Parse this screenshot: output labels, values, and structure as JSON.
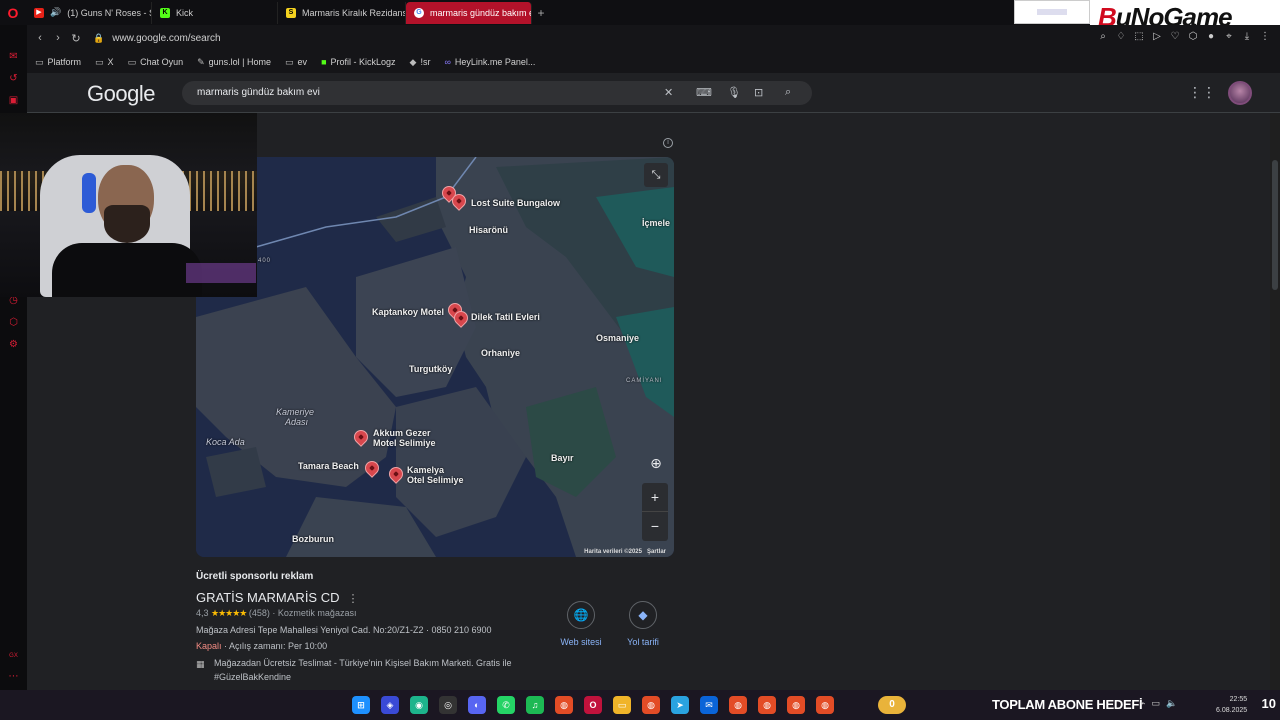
{
  "tabs": [
    {
      "label": "(1) Guns N' Roses - S",
      "fav_color": "#e62117",
      "fav_glyph": "▶"
    },
    {
      "label": "Kick",
      "fav_color": "#53fc18",
      "fav_glyph": "K"
    },
    {
      "label": "Marmaris Kiralık Rezidans",
      "fav_color": "#f4d21f",
      "fav_glyph": "S"
    },
    {
      "label": "marmaris gündüz bakım e",
      "fav_color": "#ffffff",
      "fav_glyph": "G",
      "active": true
    }
  ],
  "tab_add": "+",
  "brand": {
    "prefix": "B",
    "text": "uNoGame"
  },
  "url": "www.google.com/search",
  "bookmarks": [
    {
      "icon": "folder-icon",
      "glyph": "▭",
      "label": "Platform"
    },
    {
      "icon": "folder-icon",
      "glyph": "▭",
      "label": "X"
    },
    {
      "icon": "folder-icon",
      "glyph": "▭",
      "label": "Chat Oyun"
    },
    {
      "icon": "link-icon",
      "glyph": "✎",
      "label": "guns.lol | Home"
    },
    {
      "icon": "folder-icon",
      "glyph": "▭",
      "label": "ev"
    },
    {
      "icon": "kick-icon",
      "glyph": "■",
      "label": "Profil - KickLogz"
    },
    {
      "icon": "shield-icon",
      "glyph": "◆",
      "label": "!sr"
    },
    {
      "icon": "heylink-icon",
      "glyph": "∞",
      "label": "HeyLink.me Panel..."
    }
  ],
  "google": {
    "logo": "Google",
    "query": "marmaris gündüz bakım evi"
  },
  "map": {
    "labels": {
      "lost_suite": "Lost Suite Bungalow",
      "hisaronu": "Hisarönü",
      "icmeler": "İçmele",
      "kaptankoy": "Kaptankoy Motel",
      "dilek": "Dilek Tatil Evleri",
      "osmaniye": "Osmaniye",
      "orhaniye": "Orhaniye",
      "turgutkoy": "Turgutköy",
      "camiyani": "CAMİYANI",
      "kameriye": "Kameriye",
      "adasi": "Adası",
      "koca_ada": "Koca Ada",
      "akkum1": "Akkum Gezer",
      "akkum2": "Motel Selimiye",
      "tamara": "Tamara Beach",
      "kamelya1": "Kamelya",
      "kamelya2": "Otel Selimiye",
      "bayir": "Bayır",
      "bozburun": "Bozburun",
      "road": "400"
    },
    "attribution": "Harita verileri ©2025",
    "terms": "Şartlar",
    "zoom_in": "+",
    "zoom_out": "−"
  },
  "ad": {
    "sponsored": "Ücretli sponsorlu reklam",
    "name": "GRATİS MARMARİS CD",
    "menu": "⋮",
    "rating": "4,3",
    "stars": "★★★★★",
    "reviews": "(458)",
    "category": "· Kozmetik mağazası",
    "address": "Mağaza Adresi Tepe Mahallesi Yeniyol Cad. No:20/Z1-Z2 · 0850 210 6900",
    "status": "Kapalı",
    "opens": " · Açılış zamanı: Per 10:00",
    "delivery": "Mağazadan Ücretsiz Teslimat - Türkiye'nin Kişisel Bakım Marketi. Gratis ile #GüzelBakKendine",
    "website": "Web sitesi",
    "directions": "Yol tarifi"
  },
  "taskbar": {
    "sub_count": "0",
    "sub_goal": "TOPLAM ABONE HEDEFİ",
    "time": "22:55",
    "date": "6.08.2025",
    "corner_num": "10"
  },
  "colors": {
    "accent": "#b3122a",
    "link": "#8ab4f8",
    "closed": "#f28b82",
    "star": "#fbbc04"
  }
}
